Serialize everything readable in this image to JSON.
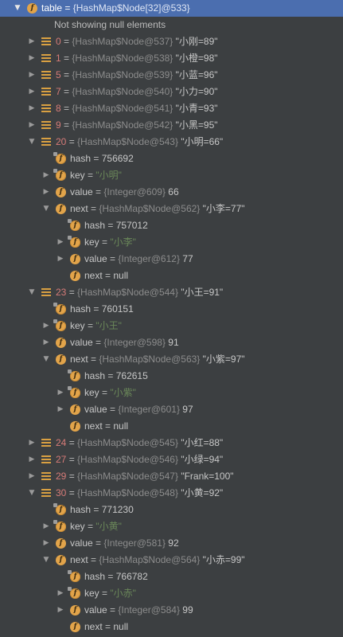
{
  "colors": {
    "background": "#3c3f41",
    "selection": "#4b6eaf",
    "index_name": "#d67b78",
    "string_value": "#6a8759",
    "type_ref": "#8c8c8c",
    "field_icon": "#e2a44a"
  },
  "rows": [
    {
      "depth": 0,
      "arrow": "down",
      "icon": "field",
      "name": "table",
      "eq": " = ",
      "type": "{HashMap$Node[32]@533}",
      "value": "",
      "selected": true
    },
    {
      "depth": 1,
      "arrow": "none",
      "icon": "none",
      "name": "",
      "eq": "",
      "type": "",
      "value": "",
      "info": "Not showing null elements"
    },
    {
      "depth": 1,
      "arrow": "right",
      "icon": "array",
      "name": "0",
      "name_class": "idx",
      "eq": " = ",
      "type": "{HashMap$Node@537}",
      "value": " \"小刚=89\""
    },
    {
      "depth": 1,
      "arrow": "right",
      "icon": "array",
      "name": "1",
      "name_class": "idx",
      "eq": " = ",
      "type": "{HashMap$Node@538}",
      "value": " \"小橙=98\""
    },
    {
      "depth": 1,
      "arrow": "right",
      "icon": "array",
      "name": "5",
      "name_class": "idx",
      "eq": " = ",
      "type": "{HashMap$Node@539}",
      "value": " \"小蓝=96\""
    },
    {
      "depth": 1,
      "arrow": "right",
      "icon": "array",
      "name": "7",
      "name_class": "idx",
      "eq": " = ",
      "type": "{HashMap$Node@540}",
      "value": " \"小力=90\""
    },
    {
      "depth": 1,
      "arrow": "right",
      "icon": "array",
      "name": "8",
      "name_class": "idx",
      "eq": " = ",
      "type": "{HashMap$Node@541}",
      "value": " \"小青=93\""
    },
    {
      "depth": 1,
      "arrow": "right",
      "icon": "array",
      "name": "9",
      "name_class": "idx",
      "eq": " = ",
      "type": "{HashMap$Node@542}",
      "value": " \"小黑=95\""
    },
    {
      "depth": 1,
      "arrow": "down",
      "icon": "array",
      "name": "20",
      "name_class": "idx",
      "eq": " = ",
      "type": "{HashMap$Node@543}",
      "value": " \"小明=66\""
    },
    {
      "depth": 2,
      "arrow": "none",
      "icon": "field-lock",
      "name": "hash",
      "eq": " = ",
      "type": "",
      "value": "756692"
    },
    {
      "depth": 2,
      "arrow": "right",
      "icon": "field-lock",
      "name": "key",
      "eq": " = ",
      "type": "",
      "value": "",
      "str": "\"小明\""
    },
    {
      "depth": 2,
      "arrow": "right",
      "icon": "field",
      "name": "value",
      "eq": " = ",
      "type": "{Integer@609}",
      "value": " 66"
    },
    {
      "depth": 2,
      "arrow": "down",
      "icon": "field",
      "name": "next",
      "eq": " = ",
      "type": "{HashMap$Node@562}",
      "value": " \"小李=77\""
    },
    {
      "depth": 3,
      "arrow": "none",
      "icon": "field-lock",
      "name": "hash",
      "eq": " = ",
      "type": "",
      "value": "757012"
    },
    {
      "depth": 3,
      "arrow": "right",
      "icon": "field-lock",
      "name": "key",
      "eq": " = ",
      "type": "",
      "value": "",
      "str": "\"小李\""
    },
    {
      "depth": 3,
      "arrow": "right",
      "icon": "field",
      "name": "value",
      "eq": " = ",
      "type": "{Integer@612}",
      "value": " 77"
    },
    {
      "depth": 3,
      "arrow": "none",
      "icon": "field",
      "name": "next",
      "eq": " = ",
      "type": "",
      "value": "null"
    },
    {
      "depth": 1,
      "arrow": "down",
      "icon": "array",
      "name": "23",
      "name_class": "idx",
      "eq": " = ",
      "type": "{HashMap$Node@544}",
      "value": " \"小王=91\""
    },
    {
      "depth": 2,
      "arrow": "none",
      "icon": "field-lock",
      "name": "hash",
      "eq": " = ",
      "type": "",
      "value": "760151"
    },
    {
      "depth": 2,
      "arrow": "right",
      "icon": "field-lock",
      "name": "key",
      "eq": " = ",
      "type": "",
      "value": "",
      "str": "\"小王\""
    },
    {
      "depth": 2,
      "arrow": "right",
      "icon": "field",
      "name": "value",
      "eq": " = ",
      "type": "{Integer@598}",
      "value": " 91"
    },
    {
      "depth": 2,
      "arrow": "down",
      "icon": "field",
      "name": "next",
      "eq": " = ",
      "type": "{HashMap$Node@563}",
      "value": " \"小紫=97\""
    },
    {
      "depth": 3,
      "arrow": "none",
      "icon": "field-lock",
      "name": "hash",
      "eq": " = ",
      "type": "",
      "value": "762615"
    },
    {
      "depth": 3,
      "arrow": "right",
      "icon": "field-lock",
      "name": "key",
      "eq": " = ",
      "type": "",
      "value": "",
      "str": "\"小紫\""
    },
    {
      "depth": 3,
      "arrow": "right",
      "icon": "field",
      "name": "value",
      "eq": " = ",
      "type": "{Integer@601}",
      "value": " 97"
    },
    {
      "depth": 3,
      "arrow": "none",
      "icon": "field",
      "name": "next",
      "eq": " = ",
      "type": "",
      "value": "null"
    },
    {
      "depth": 1,
      "arrow": "right",
      "icon": "array",
      "name": "24",
      "name_class": "idx",
      "eq": " = ",
      "type": "{HashMap$Node@545}",
      "value": " \"小红=88\""
    },
    {
      "depth": 1,
      "arrow": "right",
      "icon": "array",
      "name": "27",
      "name_class": "idx",
      "eq": " = ",
      "type": "{HashMap$Node@546}",
      "value": " \"小绿=94\""
    },
    {
      "depth": 1,
      "arrow": "right",
      "icon": "array",
      "name": "29",
      "name_class": "idx",
      "eq": " = ",
      "type": "{HashMap$Node@547}",
      "value": " \"Frank=100\""
    },
    {
      "depth": 1,
      "arrow": "down",
      "icon": "array",
      "name": "30",
      "name_class": "idx",
      "eq": " = ",
      "type": "{HashMap$Node@548}",
      "value": " \"小黄=92\""
    },
    {
      "depth": 2,
      "arrow": "none",
      "icon": "field-lock",
      "name": "hash",
      "eq": " = ",
      "type": "",
      "value": "771230"
    },
    {
      "depth": 2,
      "arrow": "right",
      "icon": "field-lock",
      "name": "key",
      "eq": " = ",
      "type": "",
      "value": "",
      "str": "\"小黄\""
    },
    {
      "depth": 2,
      "arrow": "right",
      "icon": "field",
      "name": "value",
      "eq": " = ",
      "type": "{Integer@581}",
      "value": " 92"
    },
    {
      "depth": 2,
      "arrow": "down",
      "icon": "field",
      "name": "next",
      "eq": " = ",
      "type": "{HashMap$Node@564}",
      "value": " \"小赤=99\""
    },
    {
      "depth": 3,
      "arrow": "none",
      "icon": "field-lock",
      "name": "hash",
      "eq": " = ",
      "type": "",
      "value": "766782"
    },
    {
      "depth": 3,
      "arrow": "right",
      "icon": "field-lock",
      "name": "key",
      "eq": " = ",
      "type": "",
      "value": "",
      "str": "\"小赤\""
    },
    {
      "depth": 3,
      "arrow": "right",
      "icon": "field",
      "name": "value",
      "eq": " = ",
      "type": "{Integer@584}",
      "value": " 99"
    },
    {
      "depth": 3,
      "arrow": "none",
      "icon": "field",
      "name": "next",
      "eq": " = ",
      "type": "",
      "value": "null"
    }
  ]
}
